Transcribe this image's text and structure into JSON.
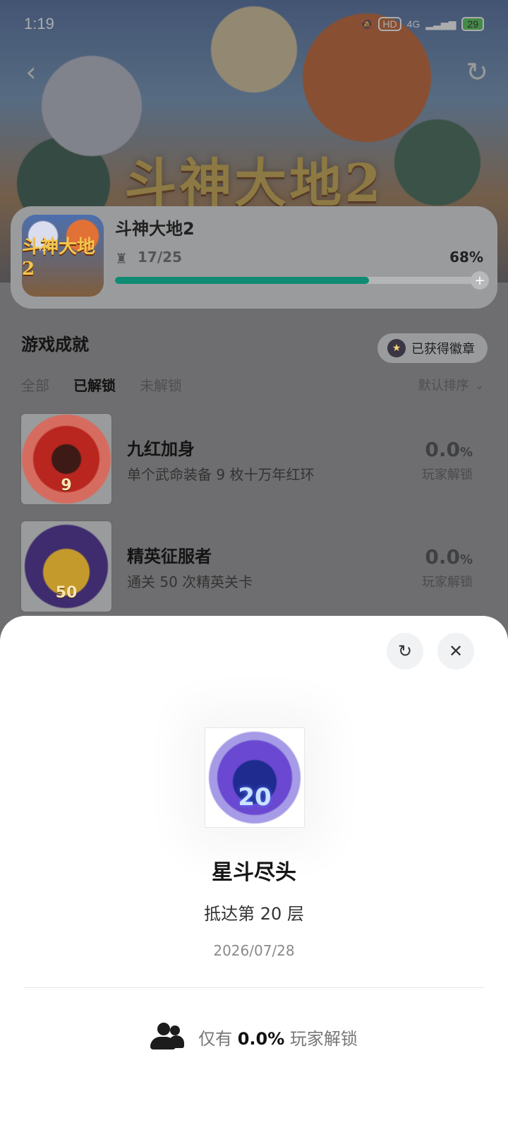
{
  "status_bar": {
    "time": "1:19",
    "signal": "4G",
    "hd_label": "HD",
    "battery": "29"
  },
  "game": {
    "title": "斗神大地2",
    "banner_title": "斗神大地2",
    "icon_text": "斗神大地2",
    "progress_count": "17/25",
    "progress_percent_label": "68%",
    "progress_fraction": 0.68
  },
  "section": {
    "title": "游戏成就",
    "badge_button": "已获得徽章"
  },
  "tabs": [
    {
      "label": "全部"
    },
    {
      "label": "已解锁"
    },
    {
      "label": "未解锁"
    }
  ],
  "sort_label": "默认排序",
  "achievements": [
    {
      "name": "九红加身",
      "desc": "单个武命装备 9 枚十万年红环",
      "pct": "0.0",
      "unit": "%",
      "sub": "玩家解锁",
      "badge_num": "9"
    },
    {
      "name": "精英征服者",
      "desc": "通关 50 次精英关卡",
      "pct": "0.0",
      "unit": "%",
      "sub": "玩家解锁",
      "badge_num": "50"
    }
  ],
  "sheet": {
    "badge_num": "20",
    "title": "星斗尽头",
    "desc": "抵达第 20 层",
    "date": "2026/07/28",
    "footer_prefix": "仅有",
    "footer_value": "0.0%",
    "footer_suffix": "玩家解锁"
  },
  "icons": {
    "back": "chevron-left",
    "share": "share",
    "close": "close",
    "trophy": "trophy",
    "people": "people"
  },
  "colors": {
    "accent": "#0f8b73"
  }
}
